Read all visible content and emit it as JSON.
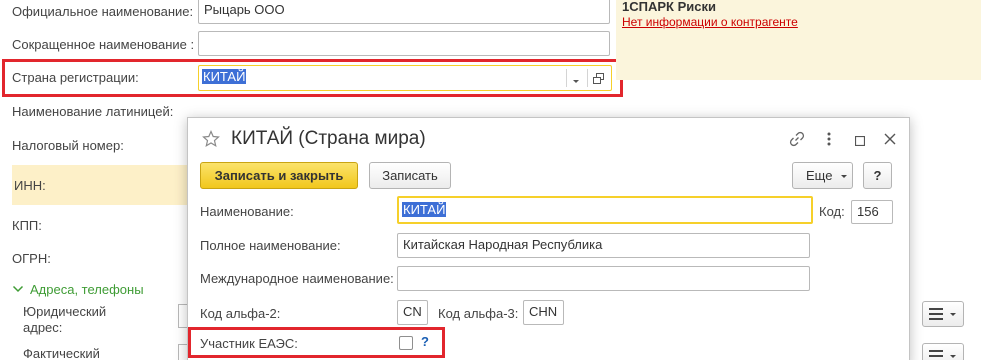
{
  "colors": {
    "accent_yellow": "#f6d02a",
    "panel_yellow": "#fbf5dc",
    "inn_yellow": "#fdf0c8",
    "red_highlight": "#e2262d",
    "link_red": "#cc0000",
    "green_group": "#3f9c35",
    "selection_blue": "#3d6fd6"
  },
  "background_form": {
    "official_name_label": "Официальное наименование:",
    "official_name_value": "Рыцарь ООО",
    "short_name_label": "Сокращенное наименование :",
    "short_name_value": "",
    "reg_country_label": "Страна регистрации:",
    "reg_country_value": "КИТАЙ",
    "latin_name_label": "Наименование латиницей:",
    "tax_number_label": "Налоговый номер:",
    "inn_label": "ИНН:",
    "kpp_label": "КПП:",
    "ogrn_label": "ОГРН:",
    "address_group_label": "Адреса, телефоны",
    "legal_address_label_1": "Юридический",
    "legal_address_label_2": "адрес:",
    "actual_address_label": "Фактический"
  },
  "spark_panel": {
    "title": "1СПАРК Риски",
    "link": "Нет информации о контрагенте"
  },
  "dialog": {
    "title": "КИТАЙ (Страна мира)",
    "save_close_label": "Записать и закрыть",
    "save_label": "Записать",
    "more_label": "Еще",
    "help_label": "?",
    "name_label": "Наименование:",
    "name_value": "КИТАЙ",
    "code_label": "Код:",
    "code_value": "156",
    "full_name_label": "Полное наименование:",
    "full_name_value": "Китайская Народная Республика",
    "intl_name_label": "Международное наименование:",
    "intl_name_value": "",
    "alpha2_label": "Код альфа-2:",
    "alpha2_value": "CN",
    "alpha3_label": "Код альфа-3:",
    "alpha3_value": "CHN",
    "eaeu_label": "Участник ЕАЭС:",
    "eaeu_help": "?"
  },
  "icons": [
    "star-icon",
    "link-icon",
    "more-vertical-icon",
    "maximize-icon",
    "close-icon",
    "dropdown-arrow-icon",
    "open-form-icon",
    "chevron-down-icon",
    "list-menu-icon"
  ]
}
